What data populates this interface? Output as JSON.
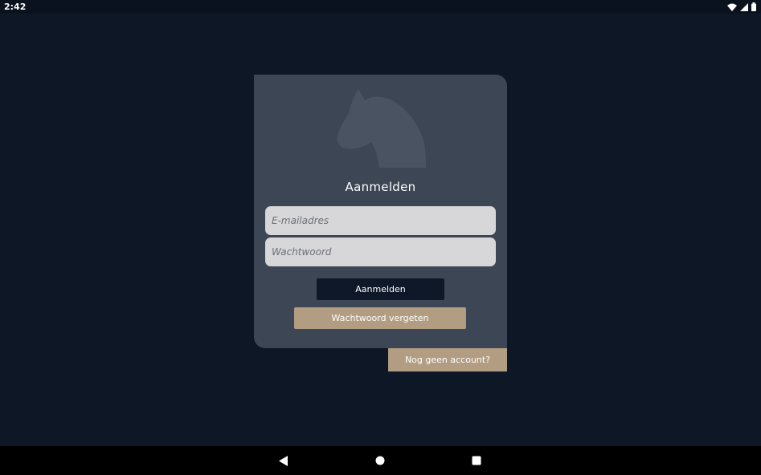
{
  "status_bar": {
    "time": "2:42",
    "icons": [
      "wifi-icon",
      "signal-icon",
      "battery-icon"
    ]
  },
  "login_card": {
    "logo": "horse-head-icon",
    "title": "Aanmelden",
    "email_placeholder": "E-mailadres",
    "email_value": "",
    "password_placeholder": "Wachtwoord",
    "password_value": "",
    "login_button_label": "Aanmelden",
    "forgot_password_label": "Wachtwoord vergeten"
  },
  "register_button_label": "Nog geen account?",
  "navigation_bar": {
    "buttons": [
      "back-icon",
      "home-icon",
      "recents-icon"
    ]
  },
  "colors": {
    "background": "#0e1726",
    "card": "#3d4654",
    "input": "#d7d7d9",
    "primary_button": "#0f1828",
    "accent_button": "#b29d82"
  }
}
